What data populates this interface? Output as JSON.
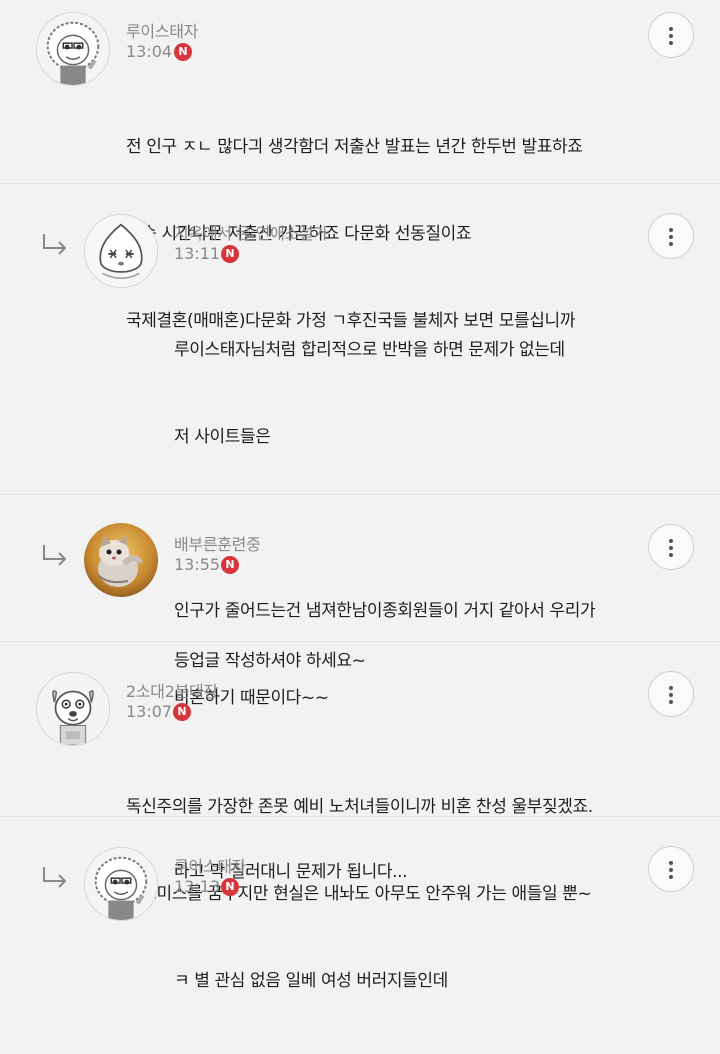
{
  "badge_label": "N",
  "comments": [
    {
      "author": "루이스태자",
      "time": "13:04",
      "avatar": "cartoon-face-bearded-icon",
      "is_reply": false,
      "lines": [
        "전 인구 ㅈㄴ 많다긔 생각함더 저출산 발표는 년간 한두번 발표하죠",
        "방송 시간나묜 저출산 가끔하죠 다문화 선동질이죠",
        "국제결혼(매매혼)다문화 가정 ㄱ후진국들 불체자 보면 모를십니까"
      ]
    },
    {
      "author": "지옥에서 온 연애소설가",
      "time": "13:11",
      "avatar": "peach-character-icon",
      "is_reply": true,
      "lines": [
        "루이스태자님처럼 합리적으로 반박을 하면 문제가 없는데",
        "저 사이트들은",
        "",
        "인구가 줄어드는건 냄져한남이종회원들이 거지 같아서 우리가",
        "비혼하기 때문이다~~",
        "",
        "라고 막 질러대니 문제가 됩니다..."
      ]
    },
    {
      "author": "배부른훈련중",
      "time": "13:55",
      "avatar": "kitten-photo-icon",
      "is_reply": true,
      "lines": [
        "등업글 작성하셔야 하세요~"
      ]
    },
    {
      "author": "2소대2분대장",
      "time": "13:07",
      "avatar": "dog-character-icon",
      "is_reply": false,
      "lines": [
        "독신주의를 가장한 존못 예비 노처녀들이니까 비혼 찬성 울부짖겠죠.",
        "골드미스를 꿈꾸지만 현실은 내놔도 아무도 안주워 가는 애들일 뿐~"
      ]
    },
    {
      "author": "루이스태자",
      "time": "13:13",
      "avatar": "cartoon-face-bearded-icon",
      "is_reply": true,
      "lines": [
        "ㅋ 별 관심 없음 일베 여성 버러지들인데"
      ]
    }
  ]
}
